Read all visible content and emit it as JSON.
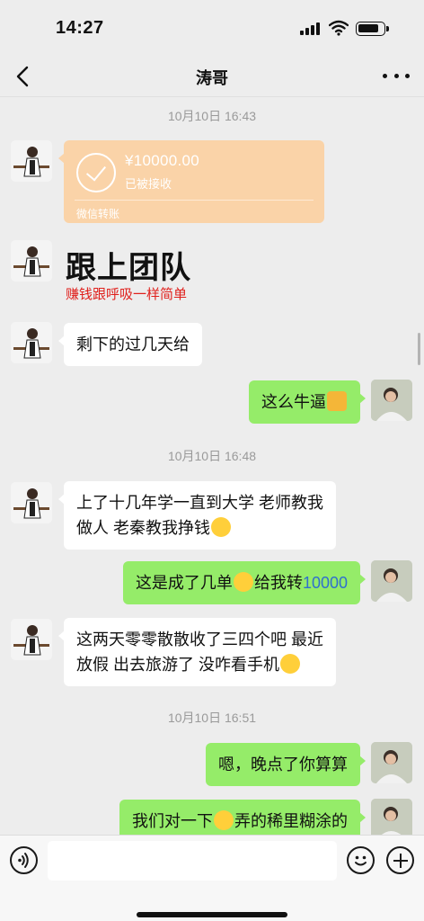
{
  "status_bar": {
    "time": "14:27"
  },
  "nav": {
    "title": "涛哥"
  },
  "colors": {
    "background": "#ededed",
    "incoming_bubble": "#ffffff",
    "outgoing_bubble": "#95ec69",
    "transfer_card": "#fad3a8",
    "promo_red": "#e0201c"
  },
  "messages": {
    "ts1": "10月10日 16:43",
    "transfer": {
      "amount": "¥10000.00",
      "status": "已被接收",
      "label": "微信转账"
    },
    "promo": {
      "title": "跟上团队",
      "subtitle": "赚钱跟呼吸一样简单"
    },
    "m1": "剩下的过几天给",
    "m2": "这么牛逼",
    "ts2": "10月10日 16:48",
    "m3_line1": "上了十几年学一直到大学 老师教我",
    "m3_line2": "做人 老秦教我挣钱",
    "m4_part1": "这是成了几单",
    "m4_part2": "给我转",
    "m4_amount": "10000",
    "m5_line1": "这两天零零散散收了三四个吧 最近",
    "m5_line2": "放假 出去旅游了 没咋看手机",
    "ts3": "10月10日 16:51",
    "m6": "嗯，晚点了你算算",
    "m7_part1": "我们对一下",
    "m7_part2": "弄的稀里糊涂的"
  },
  "icons": {
    "back": "chevron-left-icon",
    "more": "more-dots-icon",
    "voice": "voice-icon",
    "emoji": "emoji-smile-icon",
    "plus": "plus-icon"
  }
}
